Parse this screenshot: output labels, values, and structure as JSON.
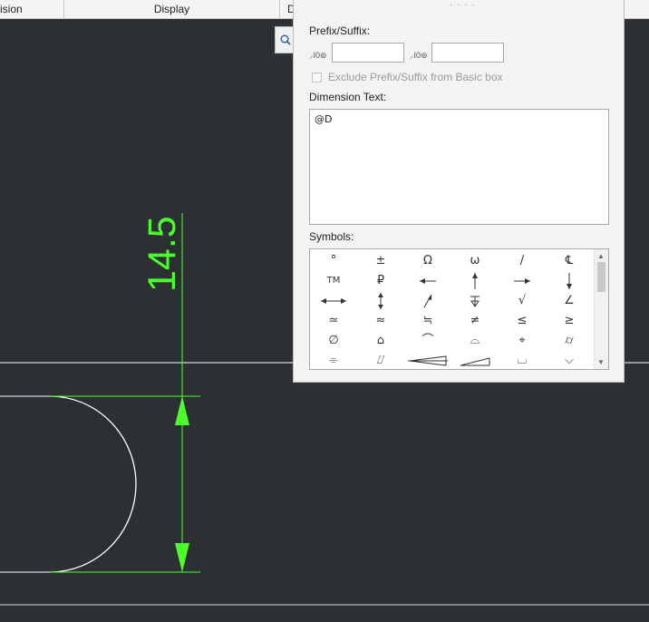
{
  "tabs": [
    "ision",
    "Display",
    "D"
  ],
  "dialog": {
    "grip": "· · · ·",
    "prefix_suffix_label": "Prefix/Suffix:",
    "prefix_icon_text": "I0⊚",
    "prefix_value": "",
    "suffix_value": "",
    "exclude_label": "Exclude Prefix/Suffix from Basic box",
    "exclude_checked": false,
    "dimension_text_label": "Dimension Text:",
    "dimension_text_value": "@D",
    "symbols_label": "Symbols:"
  },
  "symbols": [
    "degree",
    "plus-minus",
    "ohm",
    "omega",
    "slash",
    "centerline",
    "trademark",
    "property-line",
    "arrow-left",
    "arrow-up",
    "arrow-right",
    "arrow-down",
    "double-arrow-horizontal",
    "double-arrow-vertical",
    "arrow-diagonal",
    "depth",
    "square-root",
    "angle",
    "approx",
    "almost-equal",
    "approx-equal-dots",
    "not-equal",
    "less-equal",
    "greater-equal",
    "diameter",
    "profile-surface",
    "profile-line",
    "flatness-semicircle",
    "position",
    "cylindricity",
    "symmetry",
    "total-runout",
    "conical-taper",
    "slope",
    "counterbore",
    "countersink"
  ],
  "drawing": {
    "dimension_value": "14.5",
    "dimension_color": "#4cff2a",
    "geometry_color": "#ffffff",
    "background_color": "#2c3033"
  }
}
